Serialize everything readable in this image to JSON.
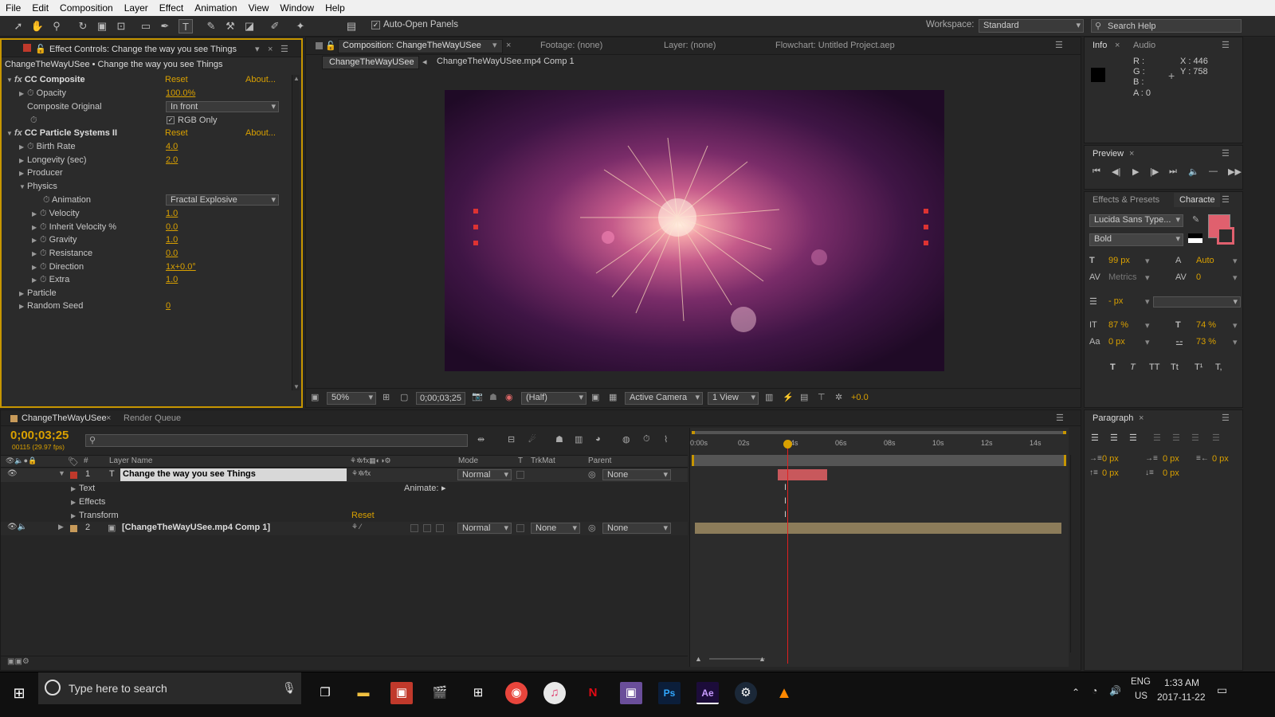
{
  "menu": [
    "File",
    "Edit",
    "Composition",
    "Layer",
    "Effect",
    "Animation",
    "View",
    "Window",
    "Help"
  ],
  "toolbar": {
    "auto_open_label": "Auto-Open Panels",
    "workspace_label": "Workspace:",
    "workspace_value": "Standard",
    "search_help_placeholder": "Search Help"
  },
  "effect_controls": {
    "tab_label": "Effect Controls: Change the way you see Things",
    "breadcrumb": "ChangeTheWayUSee • Change the way you see Things",
    "reset": "Reset",
    "about": "About...",
    "effects": [
      {
        "name": "CC Composite"
      },
      {
        "name": "CC Particle Systems II"
      }
    ],
    "props": {
      "opacity": {
        "label": "Opacity",
        "value": "100.0%"
      },
      "composite_original": {
        "label": "Composite Original",
        "value": "In front"
      },
      "rgb_only": {
        "label": "RGB Only"
      },
      "birth_rate": {
        "label": "Birth Rate",
        "value": "4.0"
      },
      "longevity": {
        "label": "Longevity (sec)",
        "value": "2.0"
      },
      "producer": {
        "label": "Producer"
      },
      "physics": {
        "label": "Physics"
      },
      "animation": {
        "label": "Animation",
        "value": "Fractal Explosive"
      },
      "velocity": {
        "label": "Velocity",
        "value": "1.0"
      },
      "inherit_velocity": {
        "label": "Inherit Velocity %",
        "value": "0.0"
      },
      "gravity": {
        "label": "Gravity",
        "value": "1.0"
      },
      "resistance": {
        "label": "Resistance",
        "value": "0.0"
      },
      "direction": {
        "label": "Direction",
        "value": "1x+0.0°"
      },
      "extra": {
        "label": "Extra",
        "value": "1.0"
      },
      "particle": {
        "label": "Particle"
      },
      "random_seed": {
        "label": "Random Seed",
        "value": "0"
      }
    }
  },
  "composition": {
    "tab_label": "Composition: ChangeTheWayUSee",
    "footage_tab": "Footage: (none)",
    "layer_tab": "Layer: (none)",
    "flowchart_tab": "Flowchart: Untitled Project.aep",
    "crumb_1": "ChangeTheWayUSee",
    "crumb_2": "ChangeTheWayUSee.mp4 Comp 1",
    "zoom": "50%",
    "timecode": "0;00;03;25",
    "resolution": "(Half)",
    "camera": "Active Camera",
    "view": "1 View",
    "exposure": "+0.0"
  },
  "info": {
    "tab": "Info",
    "audio_tab": "Audio",
    "r": "R :",
    "g": "G :",
    "b": "B :",
    "a": "A : 0",
    "x": "X : 446",
    "y": "Y : 758"
  },
  "preview": {
    "tab": "Preview"
  },
  "character": {
    "effects_presets_tab": "Effects & Presets",
    "char_tab": "Characte",
    "font": "Lucida Sans Type...",
    "style": "Bold",
    "size": "99 px",
    "leading": "Auto",
    "kerning": "Metrics",
    "tracking": "0",
    "stroke": "- px",
    "vscale": "87 %",
    "hscale": "74 %",
    "baseline": "0 px",
    "tsume": "73 %",
    "fill_color": "#e0606e",
    "styles": [
      "T",
      "T",
      "TT",
      "Tt",
      "T¹",
      "T,"
    ]
  },
  "paragraph": {
    "tab": "Paragraph",
    "indent_left": "0 px",
    "indent_first": "0 px",
    "indent_right": "0 px",
    "space_before": "0 px",
    "space_after": "0 px"
  },
  "timeline": {
    "tab": "ChangeTheWayUSee",
    "render_queue_tab": "Render Queue",
    "timecode": "0;00;03;25",
    "frame_info": "00115 (29.97 fps)",
    "col_num": "#",
    "col_layer": "Layer Name",
    "col_mode": "Mode",
    "col_t": "T",
    "col_trkmat": "TrkMat",
    "col_parent": "Parent",
    "ruler": [
      "0:00s",
      "02s",
      "04s",
      "06s",
      "08s",
      "10s",
      "12s",
      "14s"
    ],
    "layers": [
      {
        "num": "1",
        "name": "Change the way you see Things",
        "mode": "Normal",
        "trkmat": "",
        "parent": "None"
      },
      {
        "num": "2",
        "name": "[ChangeTheWayUSee.mp4 Comp 1]",
        "mode": "Normal",
        "trkmat": "None",
        "parent": "None"
      }
    ],
    "sub": {
      "text": "Text",
      "effects": "Effects",
      "transform": "Transform",
      "reset": "Reset",
      "animate": "Animate:"
    }
  },
  "taskbar": {
    "search_placeholder": "Type here to search",
    "lang": "ENG",
    "region": "US",
    "time": "1:33 AM",
    "date": "2017-11-22"
  }
}
